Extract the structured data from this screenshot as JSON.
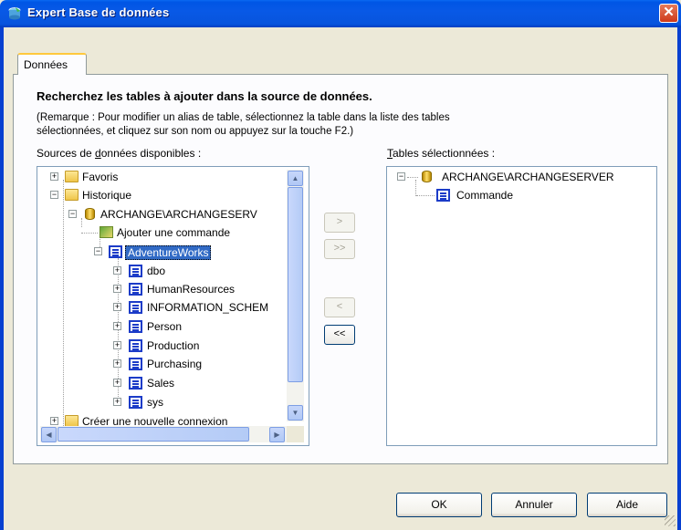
{
  "window": {
    "title": "Expert Base de données",
    "close_glyph": "✕"
  },
  "tabs": [
    {
      "label": "Données",
      "active": true
    }
  ],
  "instructions": {
    "heading": "Recherchez les tables à ajouter dans la source de données.",
    "remark_line1": "(Remarque : Pour modifier un alias de table, sélectionnez la table dans la liste des tables",
    "remark_line2": "sélectionnées, et cliquez sur son nom ou appuyez sur la touche F2.)"
  },
  "sources": {
    "label_mnemonic": "d",
    "label_before": "Sources de ",
    "label_after": "onnées disponibles :",
    "tree": [
      {
        "label": "Favoris",
        "expander": "+",
        "icon": "folder-icon"
      },
      {
        "label": "Historique",
        "expander": "−",
        "icon": "folder-icon"
      },
      {
        "label": "ARCHANGE\\ARCHANGESERV",
        "expander": "−",
        "icon": "database-icon"
      },
      {
        "label": "Ajouter une commande",
        "expander": "",
        "icon": "add-command-icon"
      },
      {
        "label": "AdventureWorks",
        "expander": "−",
        "icon": "schema-icon",
        "selected": true
      },
      {
        "label": "dbo",
        "expander": "+",
        "icon": "schema-icon"
      },
      {
        "label": "HumanResources",
        "expander": "+",
        "icon": "schema-icon"
      },
      {
        "label": "INFORMATION_SCHEM",
        "expander": "+",
        "icon": "schema-icon"
      },
      {
        "label": "Person",
        "expander": "+",
        "icon": "schema-icon"
      },
      {
        "label": "Production",
        "expander": "+",
        "icon": "schema-icon"
      },
      {
        "label": "Purchasing",
        "expander": "+",
        "icon": "schema-icon"
      },
      {
        "label": "Sales",
        "expander": "+",
        "icon": "schema-icon"
      },
      {
        "label": "sys",
        "expander": "+",
        "icon": "schema-icon"
      },
      {
        "label": "Créer une nouvelle connexion",
        "expander": "+",
        "icon": "folder-icon"
      }
    ]
  },
  "selected_tables": {
    "label_mnemonic": "T",
    "label_after": "ables sélectionnées :",
    "tree": [
      {
        "label": "ARCHANGE\\ARCHANGESERVER",
        "expander": "−",
        "icon": "database-icon"
      },
      {
        "label": "Commande",
        "expander": "",
        "icon": "schema-icon"
      }
    ]
  },
  "move_buttons": {
    "add": ">",
    "add_all": ">>",
    "remove": "<",
    "remove_all": "<<"
  },
  "buttons": {
    "ok": "OK",
    "cancel": "Annuler",
    "help": "Aide"
  },
  "scroll_glyphs": {
    "up": "▲",
    "down": "▼",
    "left": "◀",
    "right": "▶"
  },
  "colors": {
    "titlebar": "#0055e5",
    "dialog_bg": "#ece9d8",
    "selection": "#316ac5",
    "tab_highlight": "#ffc83c"
  }
}
